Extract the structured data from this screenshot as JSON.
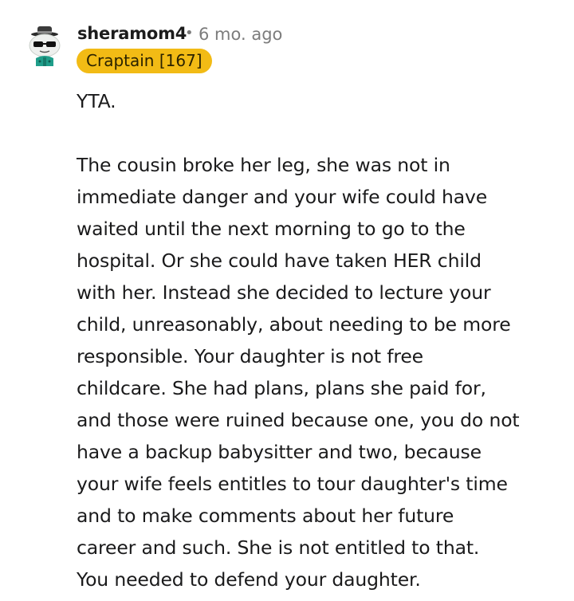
{
  "comment": {
    "author": "sheramom4",
    "separator": "•",
    "time": "6 mo. ago",
    "flair": "Craptain [167]",
    "avatar_icon": "snoo-avatar-icon",
    "paragraphs": [
      [
        "YTA."
      ],
      [
        "The cousin broke her leg, she was not in",
        "immediate danger and your wife could have",
        "waited until the next morning to go to the",
        "hospital. Or she could have taken HER child",
        "with her. Instead she decided to lecture your",
        "child, unreasonably, about needing to be more",
        "responsible. Your daughter is not free",
        "childcare. She had plans, plans she paid for,",
        "and those were ruined because one, you do not",
        "have a backup babysitter and two, because",
        "your wife feels entitles to tour daughter's time",
        "and to make comments about her future",
        "career and such. She is not entitled to that.",
        "You needed to defend your daughter."
      ]
    ]
  },
  "colors": {
    "flair_bg": "#f2bb15",
    "meta_text": "#7c7c7c",
    "body_text": "#1a1a1b"
  }
}
